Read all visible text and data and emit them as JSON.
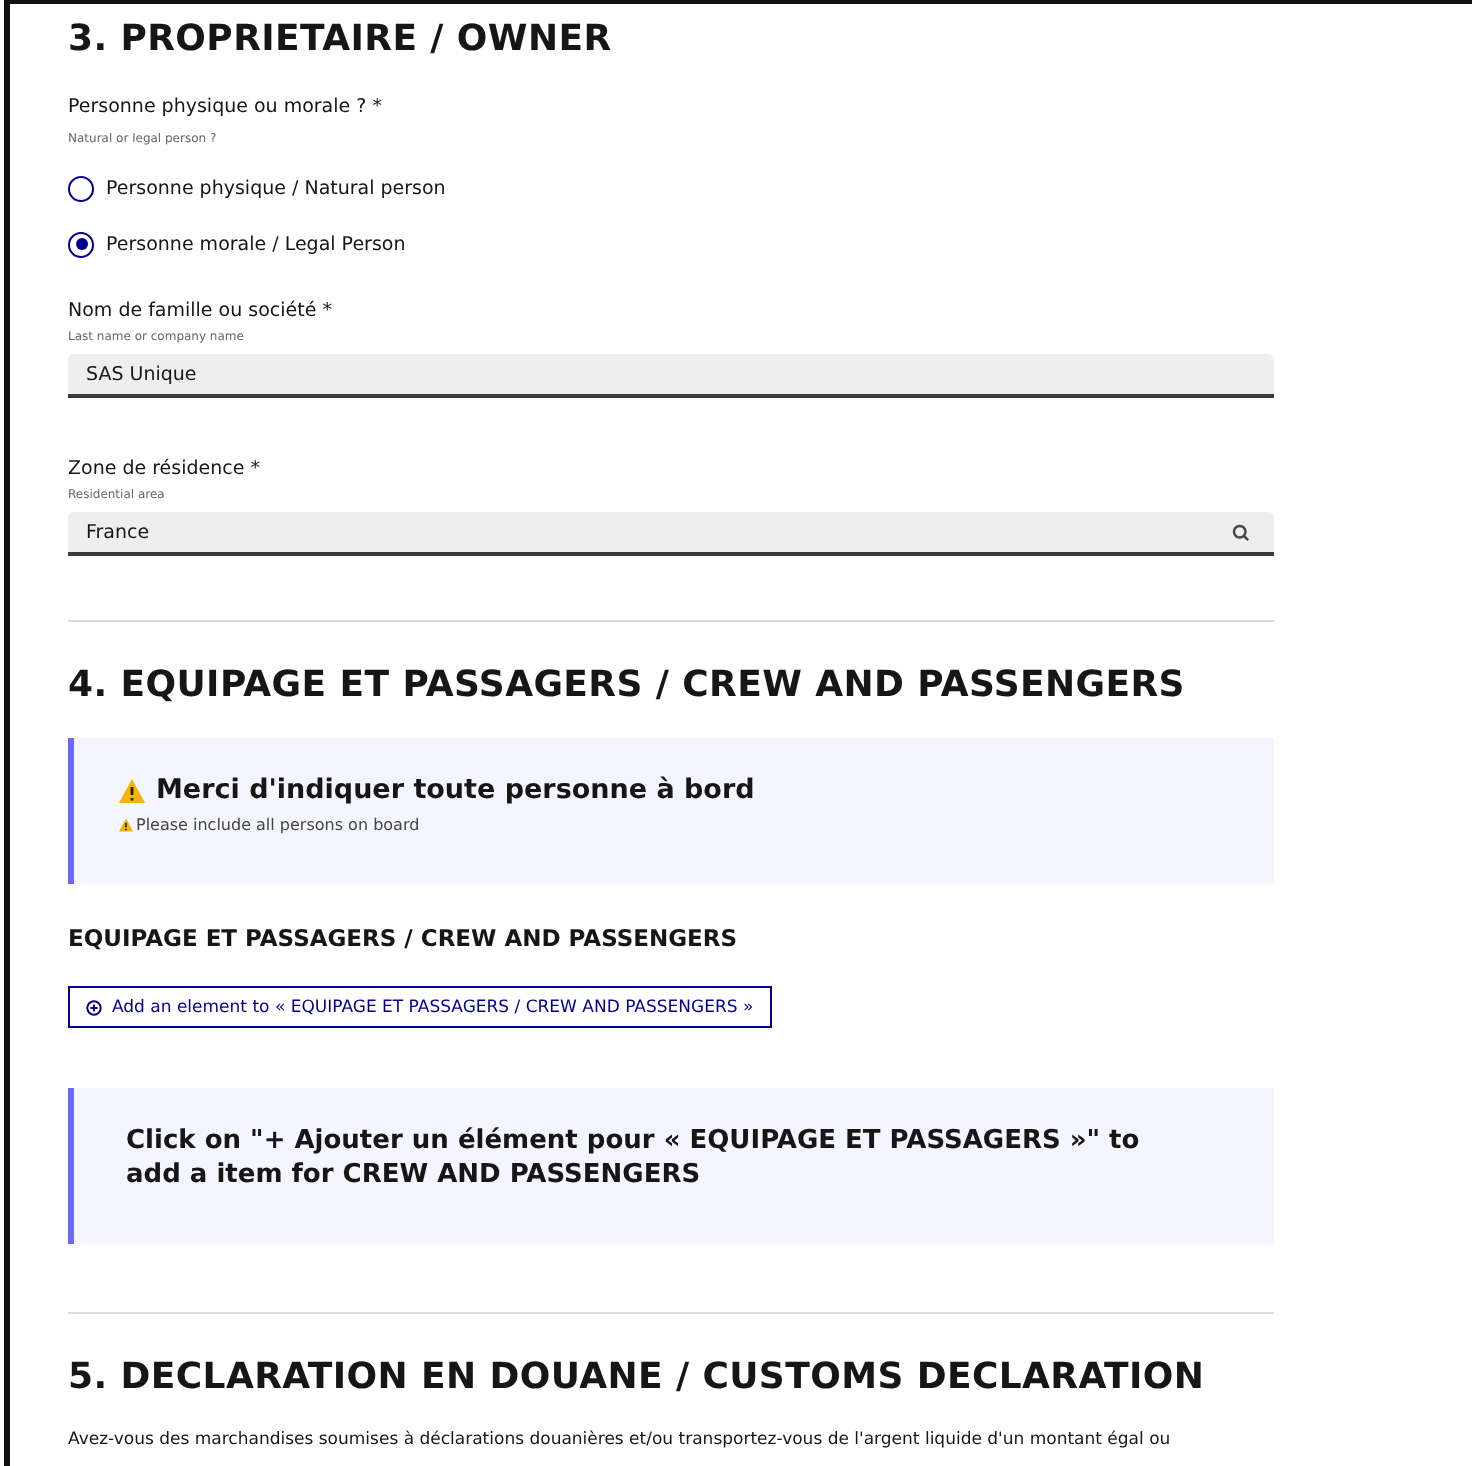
{
  "owner_section": {
    "title": "3. PROPRIETAIRE / OWNER",
    "person_type": {
      "label": "Personne physique ou morale ? *",
      "hint": "Natural or legal person ?",
      "options": [
        {
          "label": "Personne physique / Natural person",
          "selected": false
        },
        {
          "label": "Personne morale / Legal Person",
          "selected": true
        }
      ]
    },
    "fields": [
      {
        "kind": "text",
        "label": "Nom de famille ou société *",
        "hint": "Last name or company name",
        "value": "SAS Unique"
      },
      {
        "kind": "search",
        "label": "Zone de résidence *",
        "hint": "Residential area",
        "value": "France"
      }
    ]
  },
  "crew_section": {
    "title": "4. EQUIPAGE ET PASSAGERS / CREW AND PASSENGERS",
    "warning": {
      "title": "Merci d'indiquer toute personne à bord",
      "subtitle": "Please include all persons on board"
    },
    "subheading": "EQUIPAGE ET PASSAGERS / CREW AND PASSENGERS",
    "add_button": "Add an element to « EQUIPAGE ET PASSAGERS / CREW AND PASSENGERS »",
    "info": "Click on \"+ Ajouter un élément pour « EQUIPAGE ET PASSAGERS »\" to add a item for CREW AND PASSENGERS"
  },
  "customs_section": {
    "title": "5. DECLARATION EN DOUANE / CUSTOMS DECLARATION",
    "question": "Avez-vous des marchandises soumises à déclarations douanières et/ou transportez-vous de l'argent liquide d'un montant égal ou"
  }
}
